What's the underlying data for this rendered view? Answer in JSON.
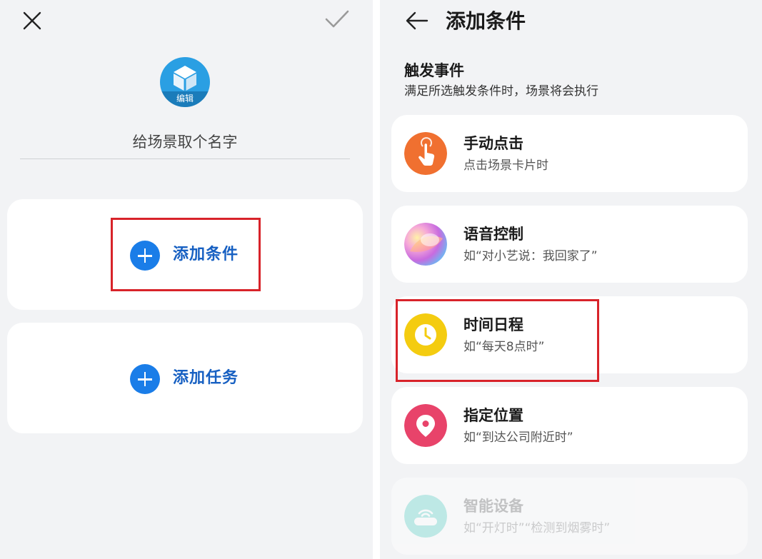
{
  "left": {
    "scene_icon_label": "编辑",
    "name_placeholder": "给场景取个名字",
    "add_condition_label": "添加条件",
    "add_task_label": "添加任务"
  },
  "right": {
    "title": "添加条件",
    "section_title": "触发事件",
    "section_subtitle": "满足所选触发条件时，场景将会执行",
    "triggers": [
      {
        "title": "手动点击",
        "subtitle": "点击场景卡片时",
        "icon": "tap-hand-icon",
        "color": "#f07030"
      },
      {
        "title": "语音控制",
        "subtitle": "如“对小艺说：我回家了”",
        "icon": "voice-assistant-icon",
        "color": "#e46fc4"
      },
      {
        "title": "时间日程",
        "subtitle": "如“每天8点时”",
        "icon": "clock-icon",
        "color": "#f4cc10"
      },
      {
        "title": "指定位置",
        "subtitle": "如“到达公司附近时”",
        "icon": "location-pin-icon",
        "color": "#e8436a"
      },
      {
        "title": "智能设备",
        "subtitle": "如“开灯时”“检测到烟雾时”",
        "icon": "smart-device-icon",
        "color": "#2ec4b6"
      }
    ]
  },
  "colors": {
    "accent_blue": "#1a7de8",
    "label_blue": "#1760c2",
    "highlight_red": "#d8232a",
    "background": "#f2f3f5"
  }
}
